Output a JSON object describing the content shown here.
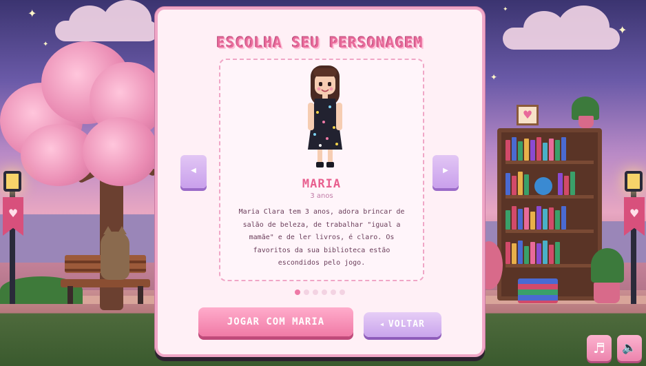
{
  "screen": {
    "title": "ESCOLHA SEU PERSONAGEM"
  },
  "character": {
    "name": "MARIA",
    "age": "3 anos",
    "description": "Maria Clara tem 3 anos, adora brincar de salão de beleza, de trabalhar \"igual a mamãe\" e de ler livros, é claro. Os favoritos da sua biblioteca estão escondidos pelo jogo."
  },
  "carousel": {
    "prev_icon": "triangle-left-icon",
    "next_icon": "triangle-right-icon",
    "prev_glyph": "◀",
    "next_glyph": "▶",
    "total_characters": 6,
    "active_index": 0
  },
  "actions": {
    "play_label": "JOGAR COM MARIA",
    "back_label": "VOLTAR",
    "back_glyph": "◀"
  },
  "controls": {
    "music_icon": "music-note-icon",
    "music_glyph": "♬",
    "sound_icon": "speaker-icon",
    "sound_glyph": "🔈"
  },
  "colors": {
    "accent_pink": "#ee79a6",
    "accent_purple": "#c9a0ec",
    "panel_bg": "#fff0f6"
  }
}
